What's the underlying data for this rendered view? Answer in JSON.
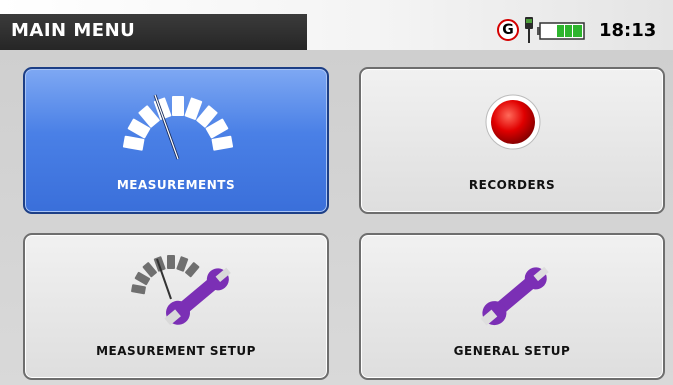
{
  "header": {
    "title": "MAIN MENU"
  },
  "status_bar": {
    "gps_symbol": "G",
    "time": "18:13"
  },
  "tiles": [
    {
      "label": "MEASUREMENTS",
      "icon": "gauge-icon",
      "selected": true
    },
    {
      "label": "RECORDERS",
      "icon": "record-icon",
      "selected": false
    },
    {
      "label": "MEASUREMENT SETUP",
      "icon": "gauge-wrench-icon",
      "selected": false
    },
    {
      "label": "GENERAL SETUP",
      "icon": "wrench-icon",
      "selected": false
    }
  ],
  "colors": {
    "accent": "#3a6fda",
    "record": "#d40000",
    "wrench": "#7b2fb5"
  }
}
